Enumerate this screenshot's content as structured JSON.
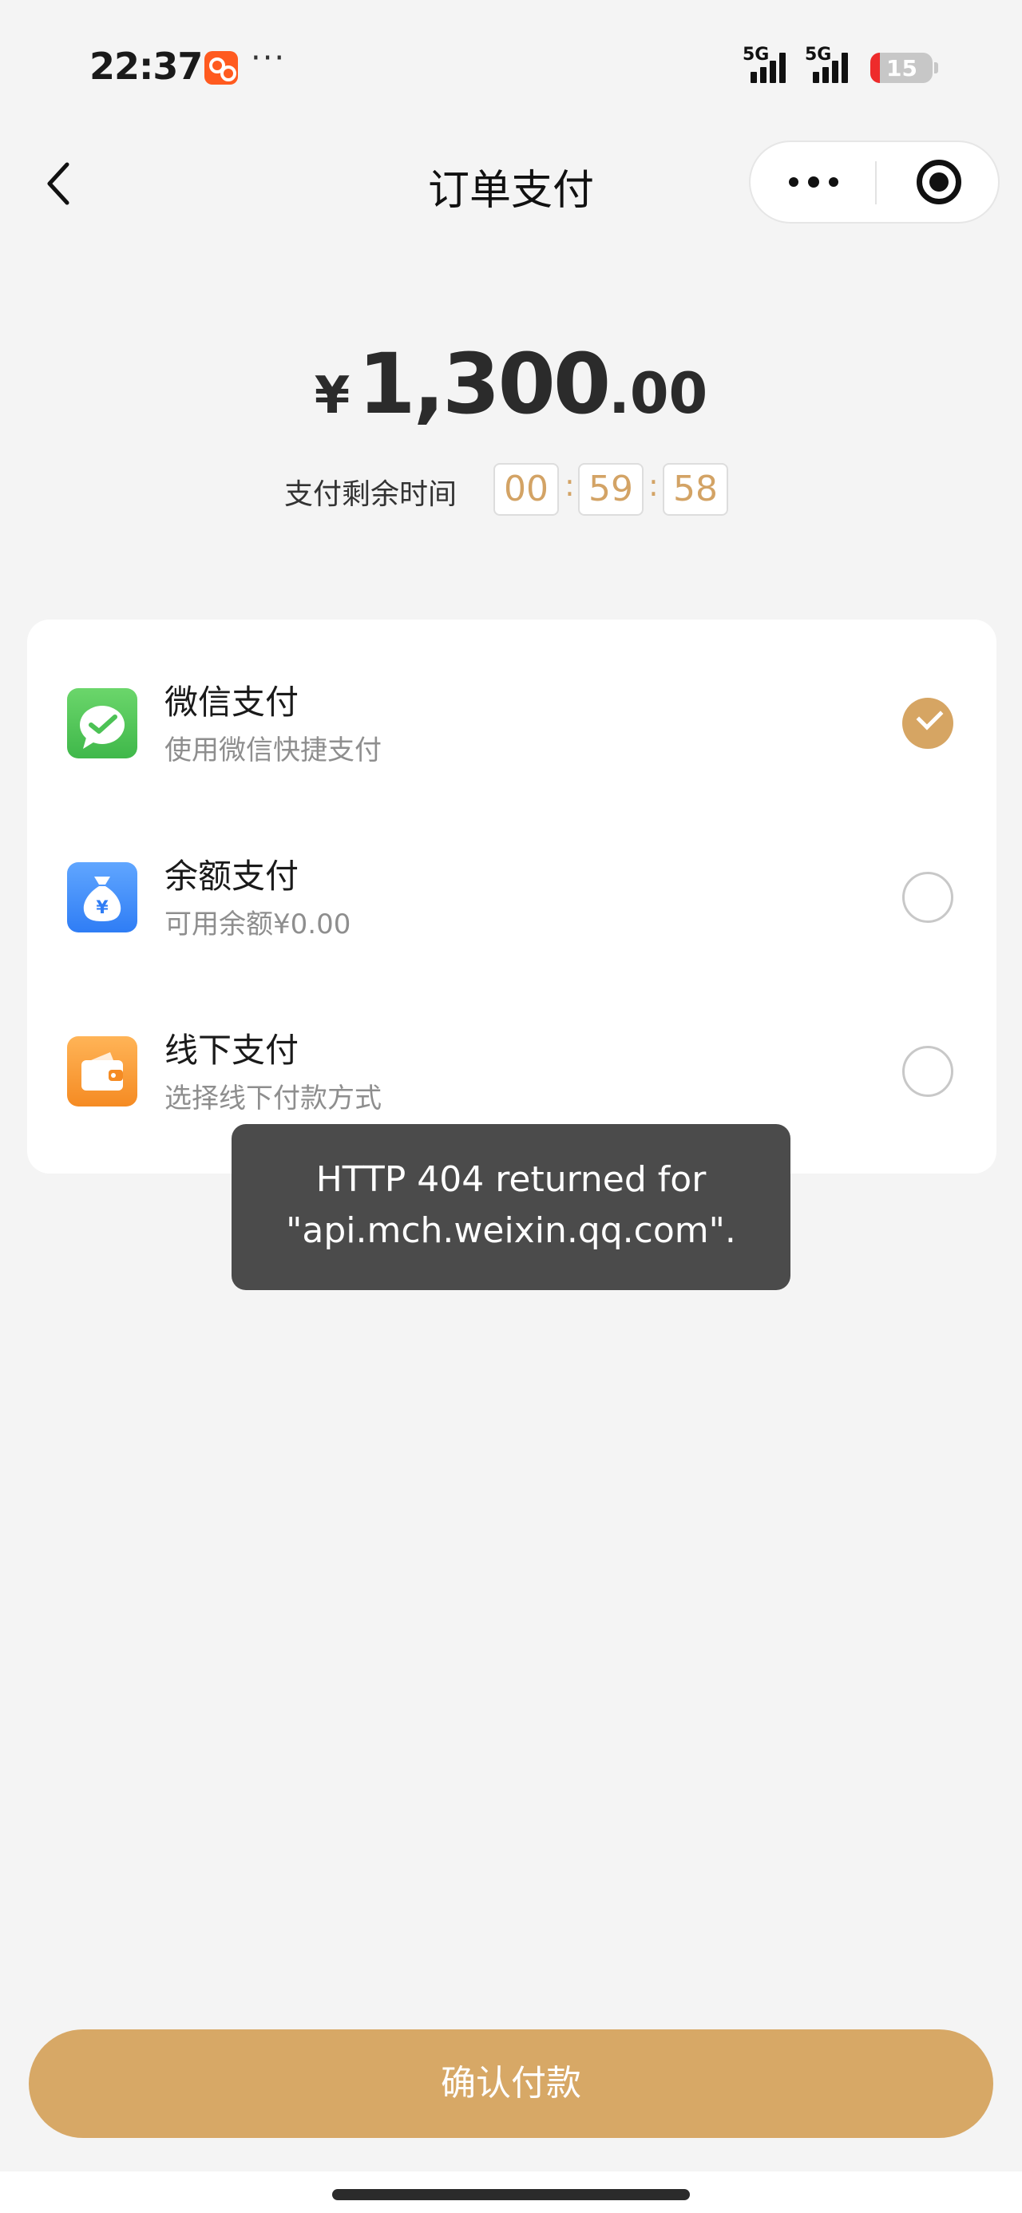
{
  "status_bar": {
    "time": "22:37",
    "more": "···",
    "network1": "5G",
    "network2": "5G",
    "battery": "15",
    "battery_level": 0.15
  },
  "nav": {
    "title": "订单支付",
    "more_icon": "more-dots-icon",
    "close_icon": "mini-program-close-icon"
  },
  "order": {
    "currency": "¥",
    "amount_integer": "1,300",
    "amount_decimal": ".00",
    "countdown_label": "支付剩余时间",
    "countdown": {
      "hours": "00",
      "minutes": "59",
      "seconds": "58",
      "separator": ":"
    }
  },
  "payment_methods": [
    {
      "title": "微信支付",
      "subtitle": "使用微信快捷支付",
      "icon": "wechat-pay-icon",
      "selected": true
    },
    {
      "title": "余额支付",
      "subtitle": "可用余额¥0.00",
      "icon": "money-bag-icon",
      "selected": false
    },
    {
      "title": "线下支付",
      "subtitle": "选择线下付款方式",
      "icon": "wallet-icon",
      "selected": false
    }
  ],
  "toast": {
    "line1": "HTTP 404 returned for",
    "line2": "\"api.mch.weixin.qq.com\"."
  },
  "confirm_button": "确认付款",
  "colors": {
    "accent": "#d7a866",
    "countdown": "#d3a365",
    "background": "#f4f4f4",
    "toast_bg": "#4b4b4b"
  }
}
